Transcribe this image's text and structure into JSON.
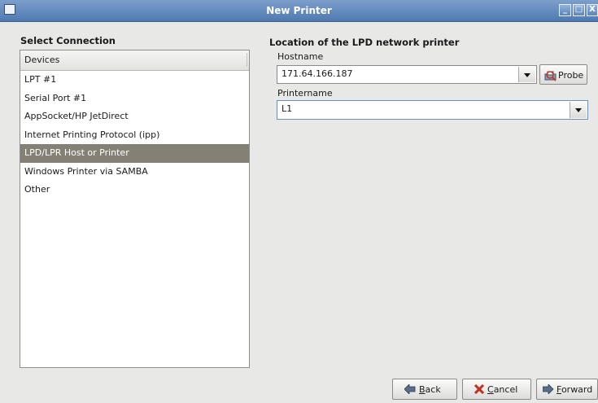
{
  "window": {
    "title": "New Printer",
    "controls": {
      "minimize": "_",
      "maximize": "□",
      "close": "X"
    }
  },
  "left": {
    "heading": "Select Connection",
    "devices_header": "Devices",
    "devices": [
      "LPT #1",
      "Serial Port #1",
      "AppSocket/HP JetDirect",
      "Internet Printing Protocol (ipp)",
      "LPD/LPR Host or Printer",
      "Windows Printer via SAMBA",
      "Other"
    ],
    "selected_device": "LPD/LPR Host or Printer"
  },
  "right": {
    "heading": "Location of the LPD network printer",
    "hostname_label": "Hostname",
    "hostname_value": "171.64.166.187",
    "probe_label": "Probe",
    "printername_label": "Printername",
    "printername_value": "L1"
  },
  "footer": {
    "back": {
      "mnemonic": "B",
      "rest": "ack"
    },
    "cancel": {
      "mnemonic": "C",
      "rest": "ancel"
    },
    "forward": {
      "mnemonic": "F",
      "rest": "orward"
    }
  }
}
